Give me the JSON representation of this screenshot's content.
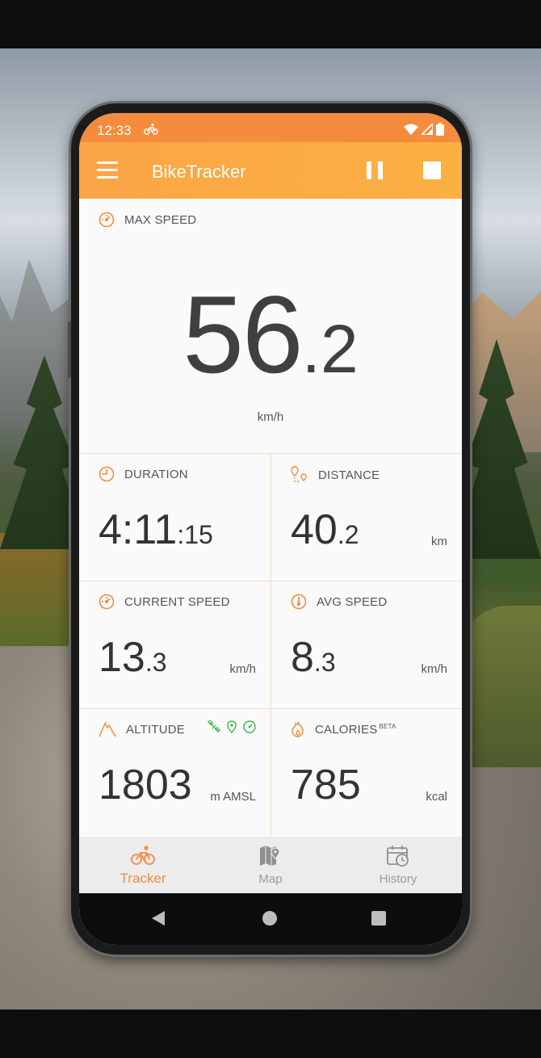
{
  "status_bar": {
    "time": "12:33",
    "icons": [
      "bike-icon",
      "wifi-icon",
      "signal-icon",
      "battery-icon"
    ]
  },
  "app_bar": {
    "title": "BikeTracker",
    "icons": [
      "menu-icon",
      "pause-icon",
      "stop-icon"
    ]
  },
  "accent_color": "#f58b3c",
  "max_speed": {
    "label": "MAX SPEED",
    "int": "56",
    "dec": ".2",
    "unit": "km/h"
  },
  "duration": {
    "label": "DURATION",
    "int": "4:11",
    "dec": ":15"
  },
  "distance": {
    "label": "DISTANCE",
    "int": "40",
    "dec": ".2",
    "unit": "km"
  },
  "current_speed": {
    "label": "CURRENT SPEED",
    "int": "13",
    "dec": ".3",
    "unit": "km/h"
  },
  "avg_speed": {
    "label": "AVG SPEED",
    "int": "8",
    "dec": ".3",
    "unit": "km/h"
  },
  "altitude": {
    "label": "ALTITUDE",
    "value": "1803",
    "unit": "m AMSL",
    "status_icons": [
      "satellite-icon",
      "location-pin-icon",
      "compass-icon"
    ]
  },
  "calories": {
    "label": "CALORIES",
    "badge": "BETA",
    "value": "785",
    "unit": "kcal"
  },
  "bottom_nav": {
    "tracker": "Tracker",
    "map": "Map",
    "history": "History",
    "active": "Tracker"
  }
}
